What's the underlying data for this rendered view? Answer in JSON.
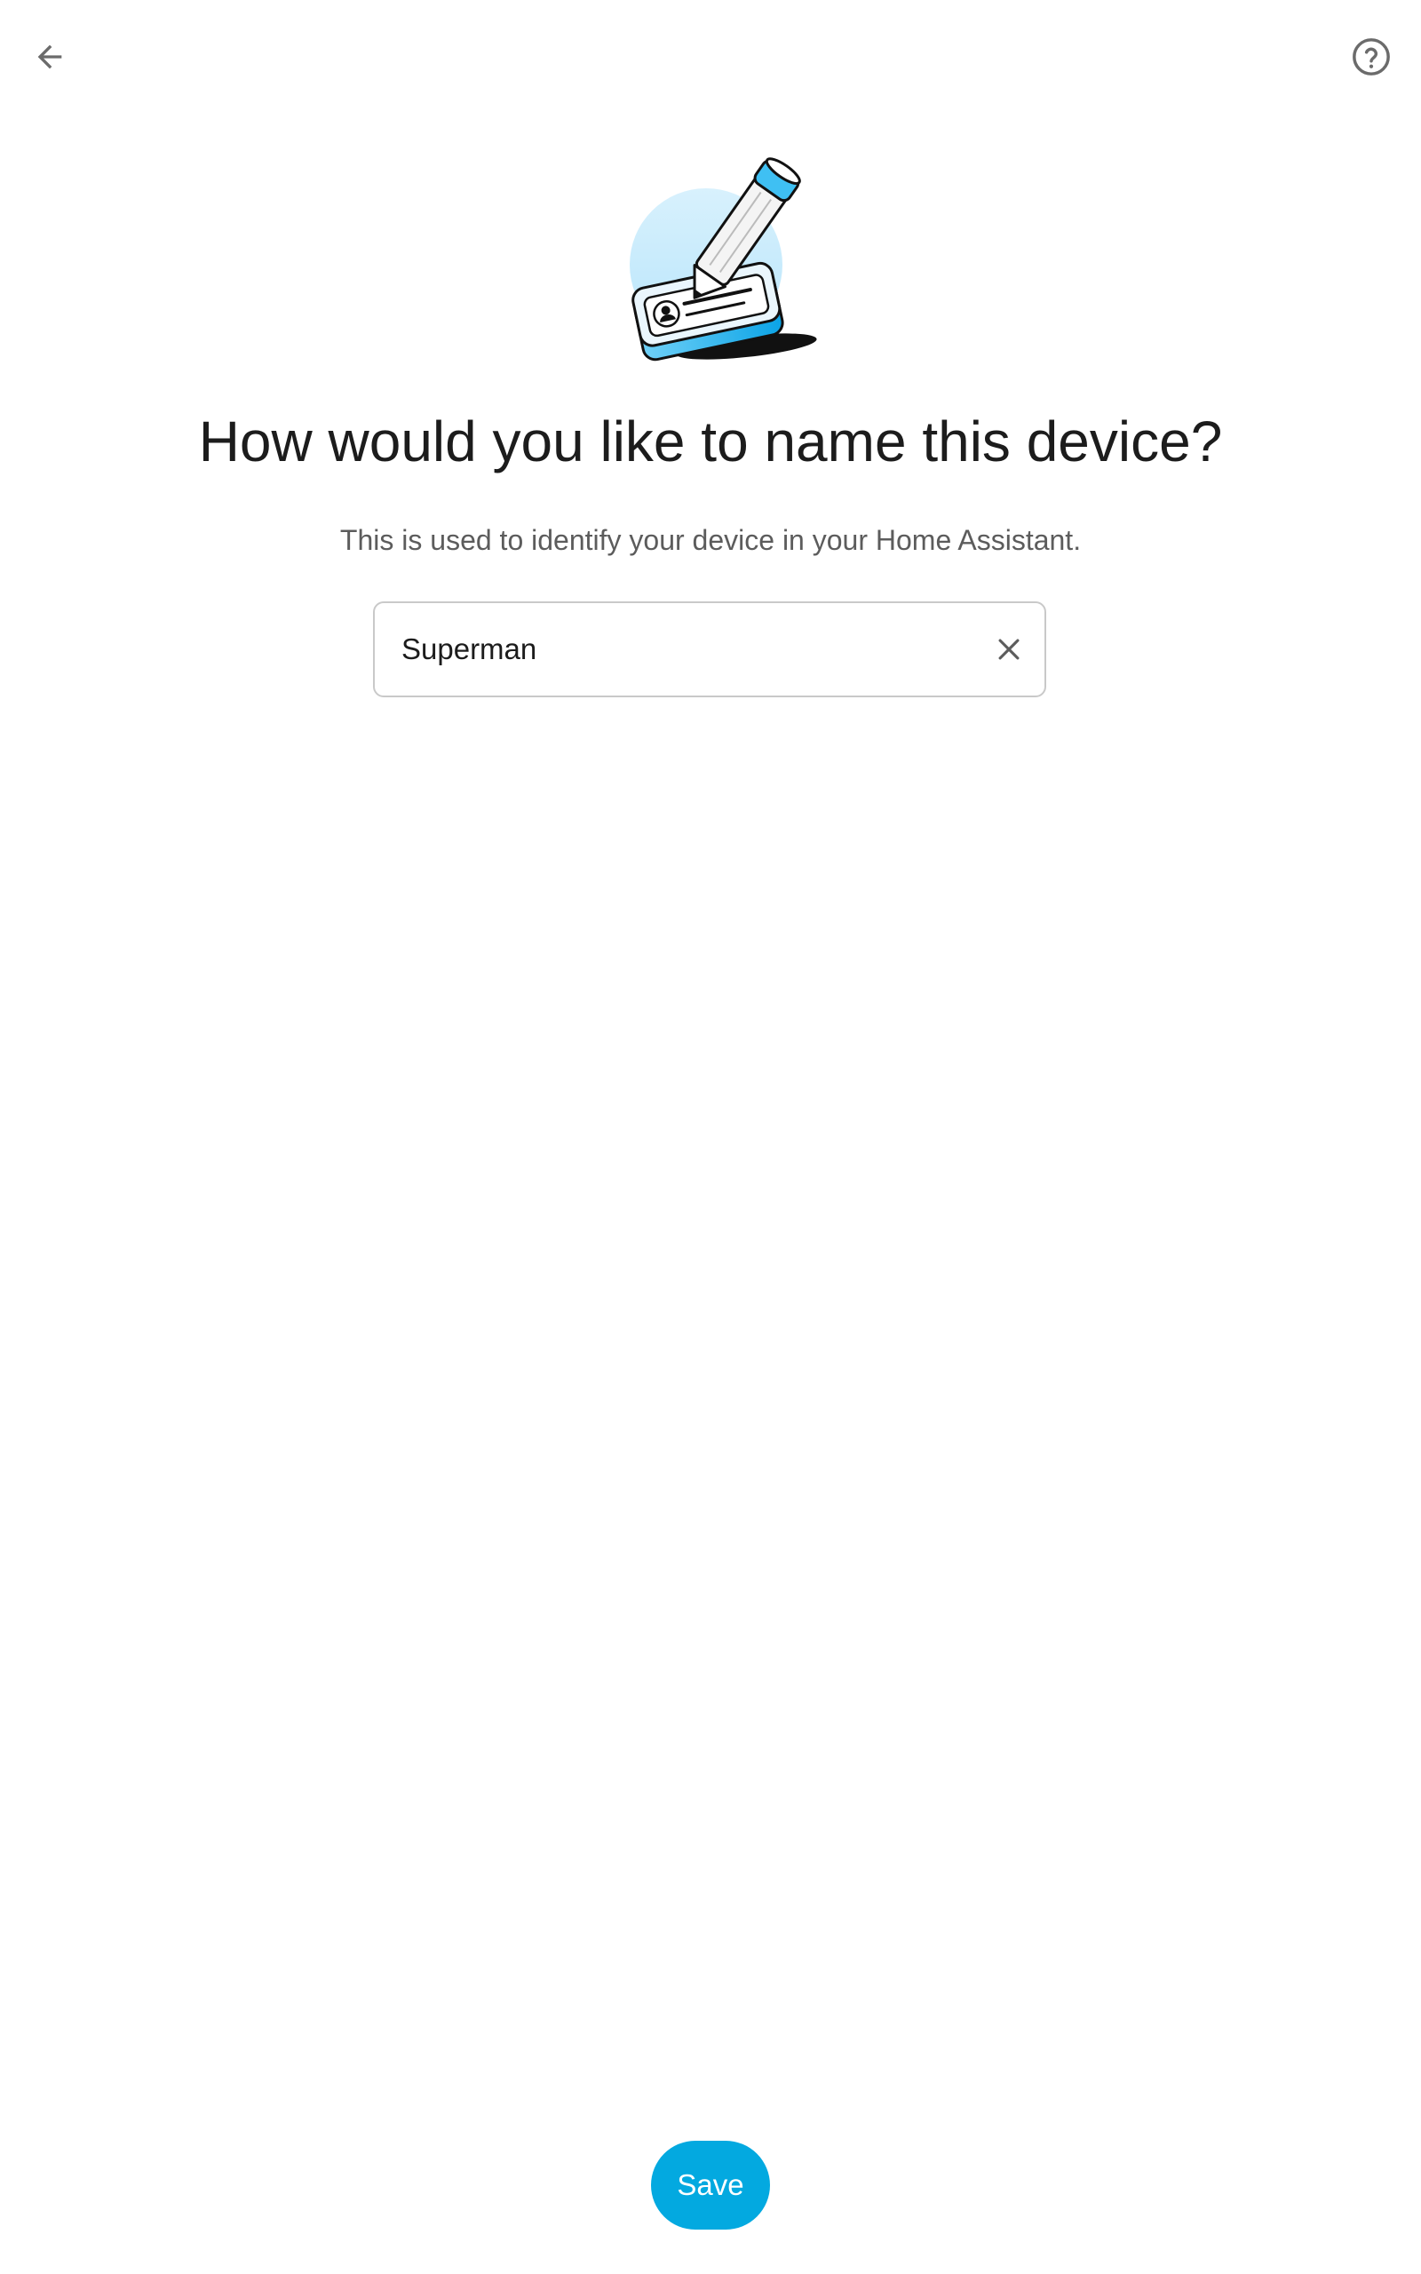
{
  "header": {
    "back_icon": "arrow-left-icon",
    "help_icon": "help-circle-icon"
  },
  "illustration": {
    "icon": "pencil-id-card-illustration",
    "accent_color": "#03a9e0"
  },
  "main": {
    "title": "How would you like to name this device?",
    "subtitle": "This is used to identify your device in your Home Assistant."
  },
  "name_field": {
    "value": "Superman",
    "clear_icon": "close-icon"
  },
  "footer": {
    "save_label": "Save",
    "button_color": "#03a9e0"
  }
}
